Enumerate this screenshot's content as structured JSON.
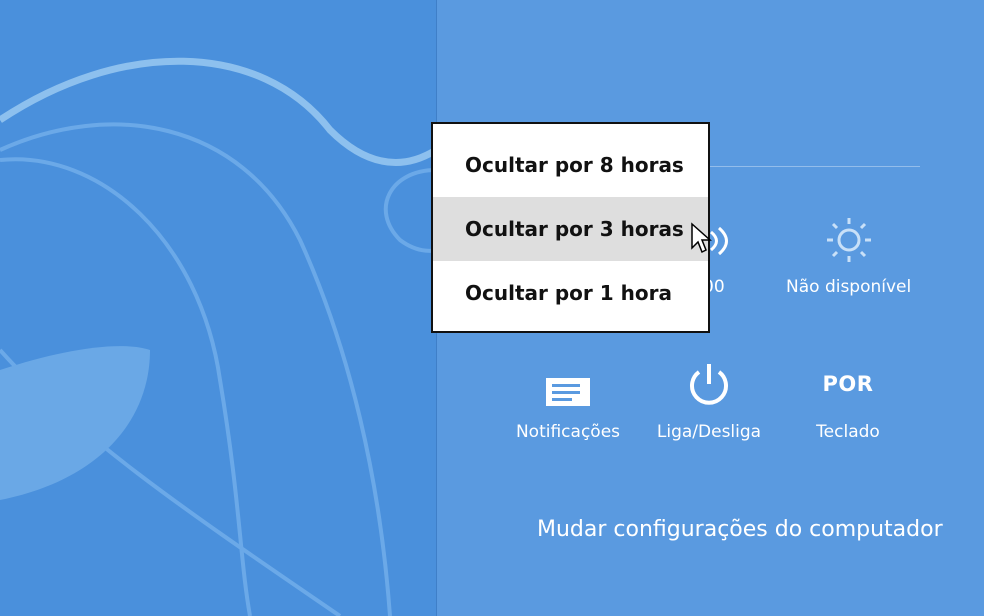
{
  "context_menu": {
    "items": [
      {
        "label": "Ocultar por 8 horas",
        "highlighted": false
      },
      {
        "label": "Ocultar por 3 horas",
        "highlighted": true
      },
      {
        "label": "Ocultar por 1 hora",
        "highlighted": false
      }
    ]
  },
  "quick_settings": {
    "network_partial_label": "00",
    "brightness_label": "Não disponível",
    "notifications_label": "Notificações",
    "power_label": "Liga/Desliga",
    "keyboard_code": "POR",
    "keyboard_label": "Teclado"
  },
  "pc_settings_link": "Mudar configurações do computador",
  "colors": {
    "desktop_bg": "#4a90dc",
    "panel_bg": "#5a9ae0",
    "menu_highlight": "#dedede"
  },
  "icons": [
    "wifi-icon",
    "brightness-icon",
    "notifications-icon",
    "power-icon",
    "mouse-pointer-icon"
  ]
}
